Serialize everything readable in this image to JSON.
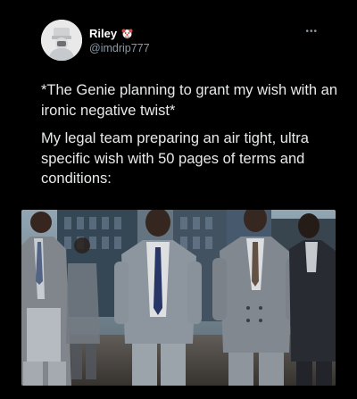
{
  "tweet": {
    "display_name": "Riley",
    "name_emoji": "clown-face-icon",
    "handle": "@imdrip777",
    "more_icon": "more-options-icon",
    "text_paragraphs": [
      "*The Genie planning to grant my wish with an ironic negative twist*",
      "My legal team preparing an air tight, ultra specific wish with 50 pages of terms and conditions:"
    ],
    "media": {
      "icon": "photo-of-men-in-suits-walking"
    }
  },
  "colors": {
    "background": "#000000",
    "text_primary": "#e7e9ea",
    "text_secondary": "#8b98a5",
    "name": "#ffffff"
  }
}
